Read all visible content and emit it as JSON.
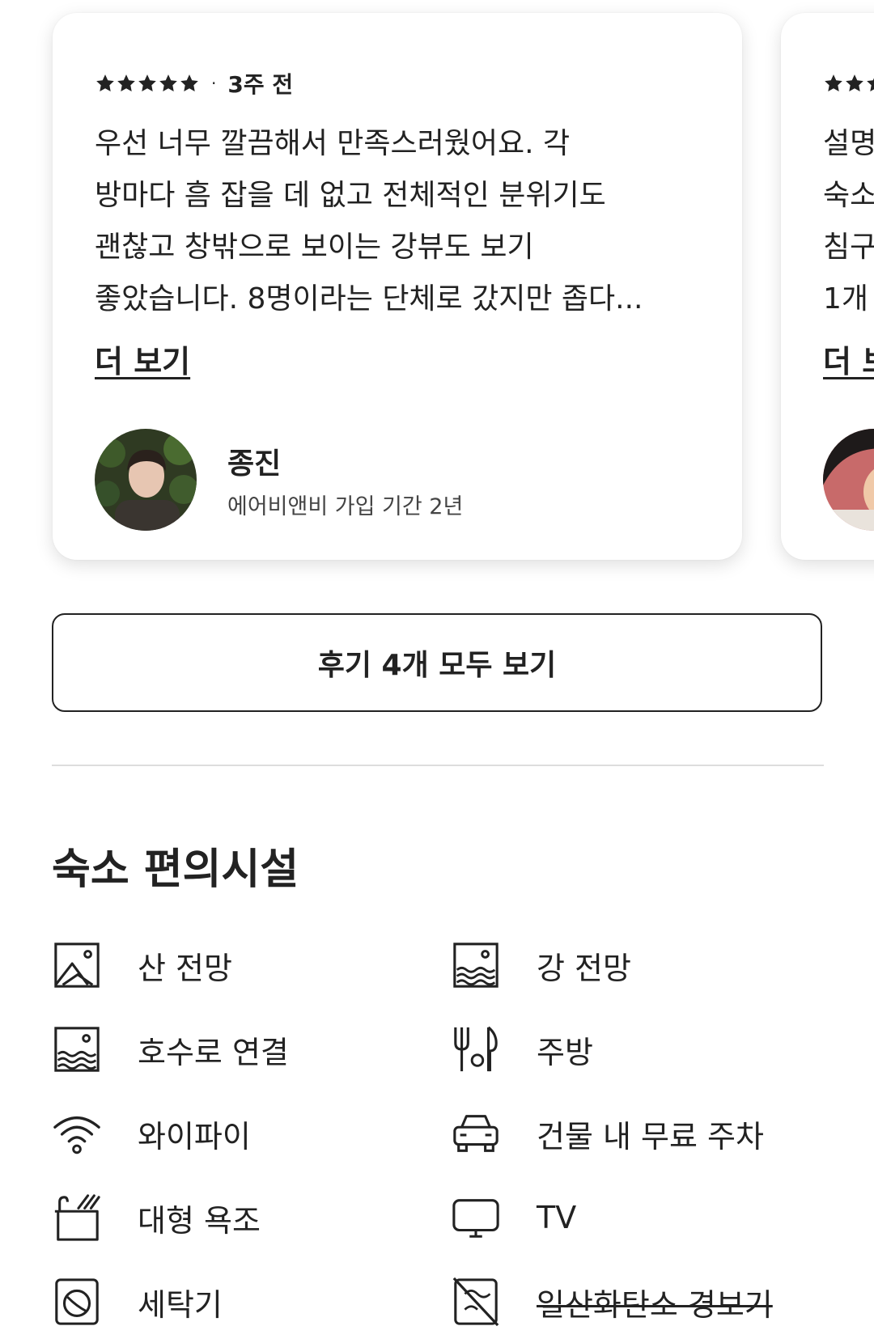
{
  "reviews": [
    {
      "time": "3주 전",
      "rating": 5,
      "text_lines": [
        "우선 너무 깔끔해서 만족스러웠어요. 각",
        "방마다 흠 잡을 데 없고 전체적인 분위기도",
        "괜찮고 창밖으로 보이는 강뷰도 보기",
        "좋았습니다. 8명이라는 단체로 갔지만 좁다..."
      ],
      "more_label": "더 보기",
      "reviewer_name": "종진",
      "reviewer_meta": "에어비앤비 가입 기간 2년"
    },
    {
      "time": "",
      "rating": 5,
      "text_lines": [
        "설명",
        "숙소",
        "침구",
        "1개"
      ],
      "more_label": "더 보",
      "reviewer_name": "",
      "reviewer_meta": ""
    }
  ],
  "show_all_button": "후기 4개 모두 보기",
  "amenities_section": {
    "title": "숙소 편의시설",
    "items": [
      {
        "label": "산 전망",
        "icon": "mountain-view-icon",
        "available": true
      },
      {
        "label": "강 전망",
        "icon": "river-view-icon",
        "available": true
      },
      {
        "label": "호수로 연결",
        "icon": "lake-access-icon",
        "available": true
      },
      {
        "label": "주방",
        "icon": "kitchen-icon",
        "available": true
      },
      {
        "label": "와이파이",
        "icon": "wifi-icon",
        "available": true
      },
      {
        "label": "건물 내 무료 주차",
        "icon": "parking-icon",
        "available": true
      },
      {
        "label": "대형 욕조",
        "icon": "bathtub-icon",
        "available": true
      },
      {
        "label": "TV",
        "icon": "tv-icon",
        "available": true
      },
      {
        "label": "세탁기",
        "icon": "washer-icon",
        "available": true
      },
      {
        "label": "일산화탄소 경보기",
        "icon": "co-alarm-off-icon",
        "available": false
      }
    ]
  }
}
